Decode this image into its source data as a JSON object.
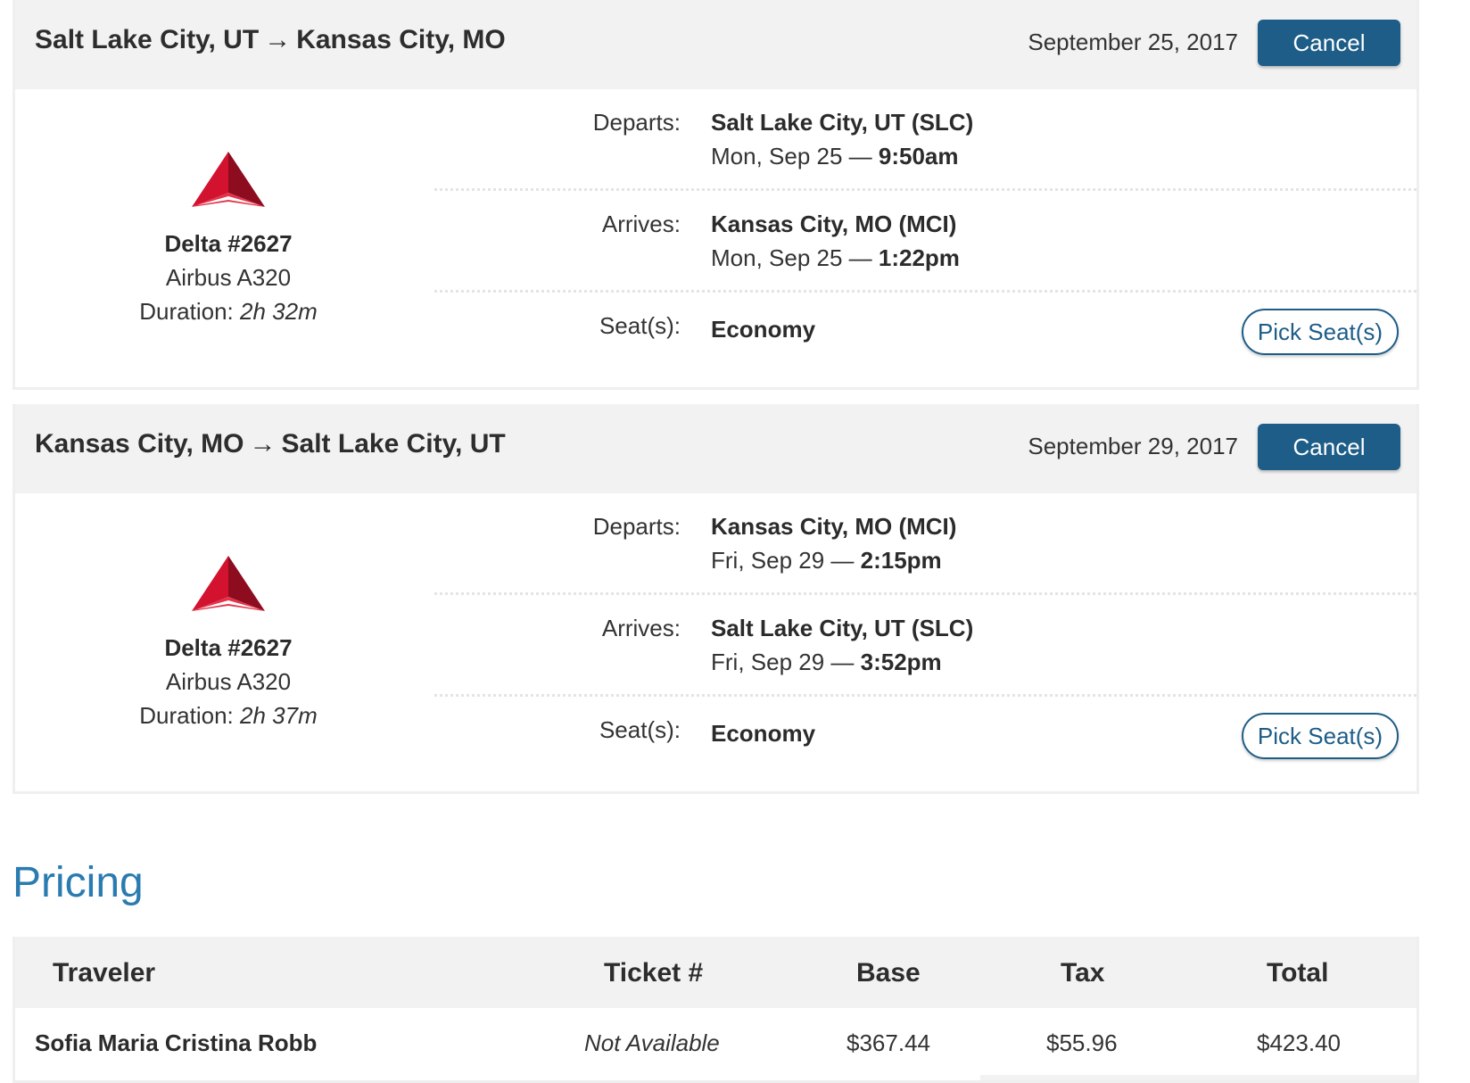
{
  "flights": [
    {
      "route_from": "Salt Lake City, UT",
      "route_to": "Kansas City, MO",
      "arrow": "→",
      "date": "September 25, 2017",
      "cancel_label": "Cancel",
      "flight_no": "Delta #2627",
      "aircraft": "Airbus A320",
      "duration_label": "Duration:",
      "duration_value": "2h 32m",
      "departs_label": "Departs:",
      "departs_place": "Salt Lake City, UT (SLC)",
      "departs_day": "Mon, Sep 25 —",
      "departs_time": "9:50am",
      "arrives_label": "Arrives:",
      "arrives_place": "Kansas City, MO (MCI)",
      "arrives_day": "Mon, Sep 25 —",
      "arrives_time": "1:22pm",
      "seats_label": "Seat(s):",
      "seat_class": "Economy",
      "pick_label": "Pick Seat(s)"
    },
    {
      "route_from": "Kansas City, MO",
      "route_to": "Salt Lake City, UT",
      "arrow": "→",
      "date": "September 29, 2017",
      "cancel_label": "Cancel",
      "flight_no": "Delta #2627",
      "aircraft": "Airbus A320",
      "duration_label": "Duration:",
      "duration_value": "2h 37m",
      "departs_label": "Departs:",
      "departs_place": "Kansas City, MO (MCI)",
      "departs_day": "Fri, Sep 29 —",
      "departs_time": "2:15pm",
      "arrives_label": "Arrives:",
      "arrives_place": "Salt Lake City, UT (SLC)",
      "arrives_day": "Fri, Sep 29 —",
      "arrives_time": "3:52pm",
      "seats_label": "Seat(s):",
      "seat_class": "Economy",
      "pick_label": "Pick Seat(s)"
    }
  ],
  "pricing": {
    "heading": "Pricing",
    "columns": [
      "Traveler",
      "Ticket #",
      "Base",
      "Tax",
      "Total"
    ],
    "rows": [
      {
        "traveler": "Sofia Maria Cristina Robb",
        "ticket": "Not Available",
        "base": "$367.44",
        "tax": "$55.96",
        "total": "$423.40"
      }
    ]
  },
  "colors": {
    "primary_button": "#1d5d88",
    "heading_blue": "#2a7bb0",
    "header_bg": "#f2f2f2",
    "delta_red": "#c8102e"
  },
  "icons": [
    "delta-logo-icon"
  ]
}
